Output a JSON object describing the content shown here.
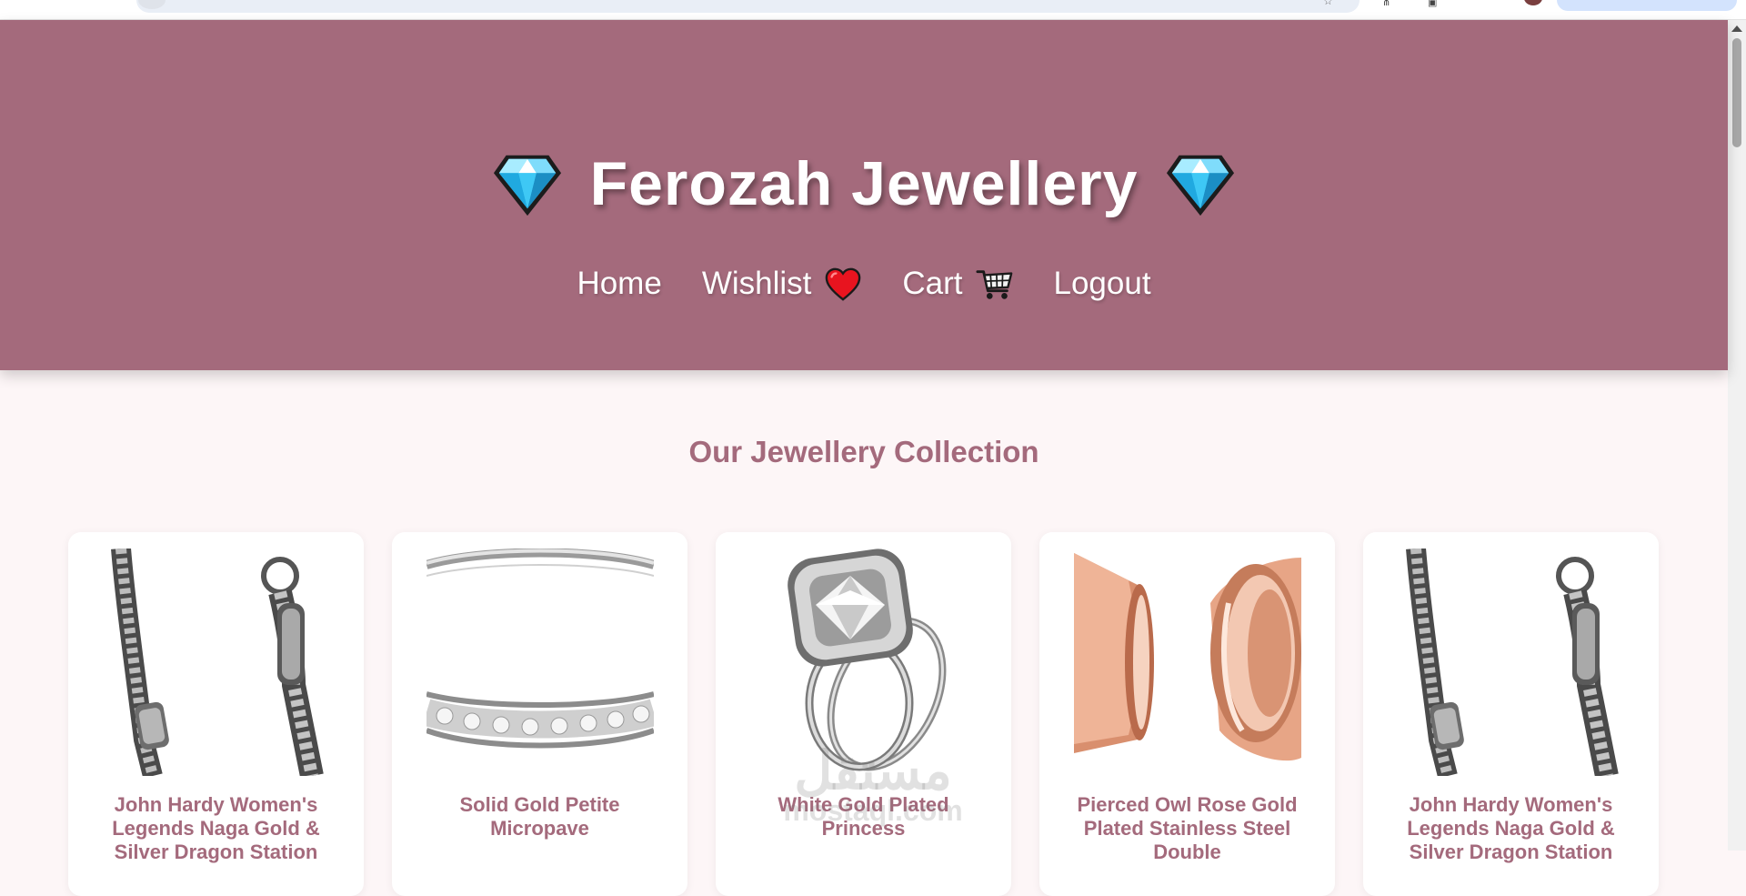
{
  "browser": {
    "star_icon": "☆",
    "ext1_icon": "⋔",
    "ext2_icon": "▣"
  },
  "header": {
    "title": "Ferozah Jewellery",
    "left_icon": "diamond-icon",
    "right_icon": "diamond-icon",
    "background": "#a46a7c"
  },
  "nav": {
    "items": [
      {
        "label": "Home",
        "icon": null
      },
      {
        "label": "Wishlist",
        "icon": "heart-icon"
      },
      {
        "label": "Cart",
        "icon": "cart-icon"
      },
      {
        "label": "Logout",
        "icon": null
      }
    ]
  },
  "main": {
    "section_title": "Our Jewellery Collection",
    "accent": "#a46a7c",
    "products": [
      {
        "name": "John Hardy Women's Legends Naga Gold & Silver Dragon Station",
        "image": "silver-chain-bracelet"
      },
      {
        "name": "Solid Gold Petite Micropave",
        "image": "diamond-band-ring"
      },
      {
        "name": "White Gold Plated Princess",
        "image": "halo-engagement-ring"
      },
      {
        "name": "Pierced Owl Rose Gold Plated Stainless Steel Double",
        "image": "rose-gold-tunnels"
      },
      {
        "name": "John Hardy Women's Legends Naga Gold & Silver Dragon Station",
        "image": "silver-chain-bracelet"
      }
    ]
  },
  "watermark": {
    "arabic": "مستقل",
    "latin": "mostaql.com"
  }
}
